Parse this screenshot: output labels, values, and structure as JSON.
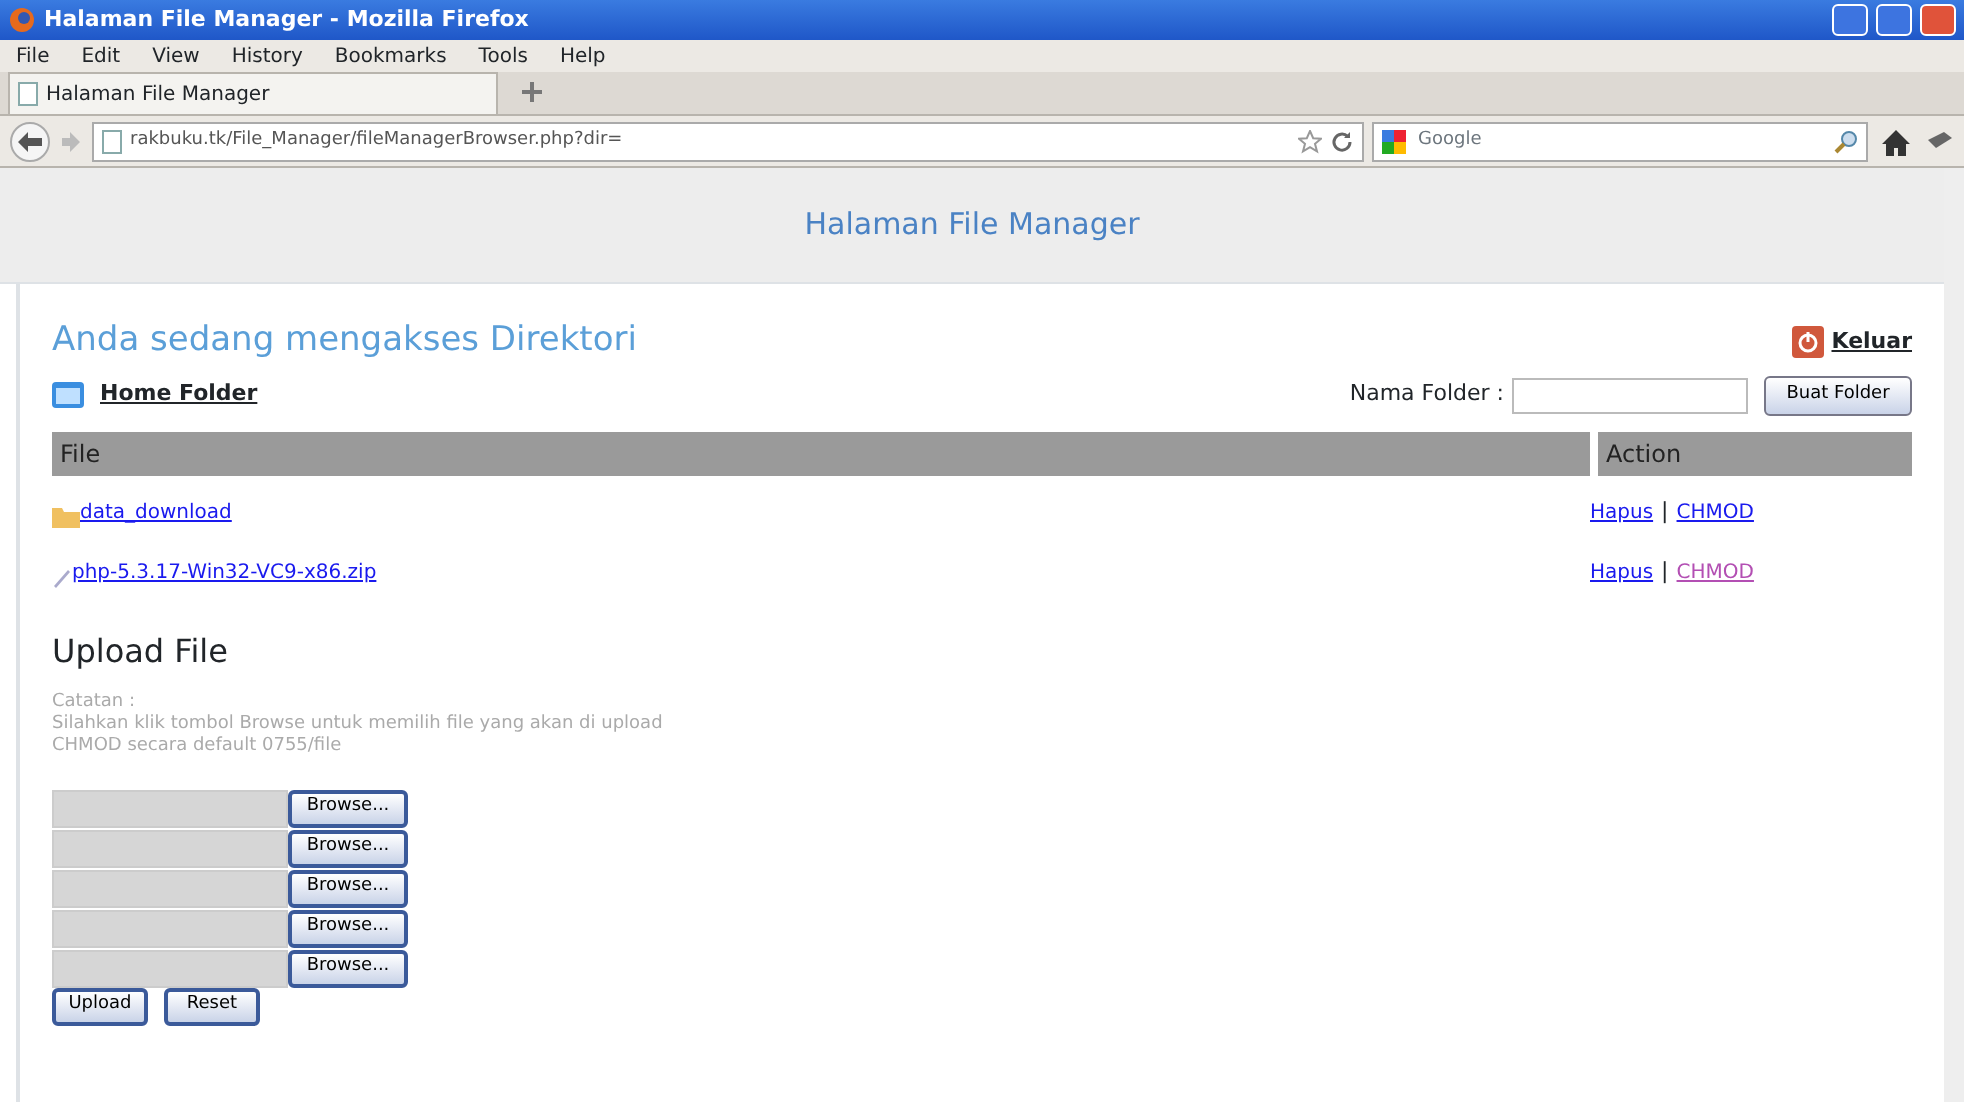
{
  "window": {
    "title": "Halaman File Manager - Mozilla Firefox"
  },
  "menu": [
    "File",
    "Edit",
    "View",
    "History",
    "Bookmarks",
    "Tools",
    "Help"
  ],
  "tabs": [
    {
      "label": "Halaman File Manager",
      "selected": true
    }
  ],
  "address_bar": {
    "url": "rakbuku.tk/File_Manager/fileManagerBrowser.php?dir="
  },
  "search": {
    "placeholder": "Google"
  },
  "page": {
    "header": "Halaman File Manager",
    "heading": "Anda sedang mengakses Direktori",
    "logout": "Keluar",
    "home_link": "Home Folder",
    "folder_label": "Nama Folder :",
    "folder_button": "Buat Folder",
    "table": {
      "columns": [
        "File",
        "Action"
      ],
      "rows": [
        {
          "kind": "folder",
          "name": "data_download",
          "separator": "|",
          "actions": [
            {
              "label": "Hapus",
              "visited": false
            },
            {
              "label": "CHMOD",
              "visited": false
            }
          ]
        },
        {
          "kind": "file",
          "name": "php-5.3.17-Win32-VC9-x86.zip",
          "separator": "|",
          "actions": [
            {
              "label": "Hapus",
              "visited": false
            },
            {
              "label": "CHMOD",
              "visited": true
            }
          ]
        }
      ]
    },
    "upload": {
      "title": "Upload File",
      "notes": [
        "Catatan :",
        "Silahkan klik tombol Browse untuk memilih file yang akan di upload",
        "CHMOD secara default 0755/file"
      ],
      "fields": [
        {
          "button": "Browse..."
        },
        {
          "button": "Browse..."
        },
        {
          "button": "Browse..."
        },
        {
          "button": "Browse..."
        },
        {
          "button": "Browse..."
        }
      ],
      "buttons": [
        "Upload",
        "Reset"
      ]
    }
  }
}
